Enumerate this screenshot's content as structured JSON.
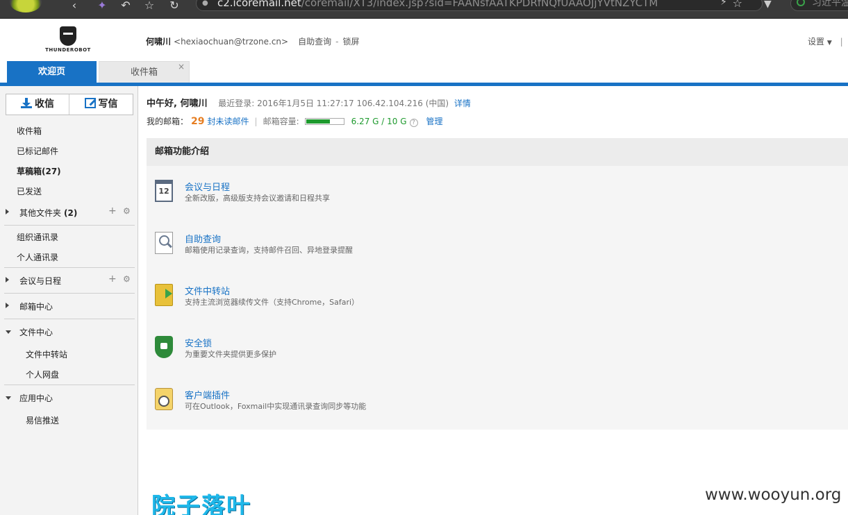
{
  "browser": {
    "url_host": "c2.icoremail.net",
    "url_path": "/coremail/XT3/index.jsp?sid=FAANsfAATKPDRfNQfUAAOJjYVtNZYCTM",
    "search_text": "习近平温"
  },
  "header": {
    "logo_text": "THUNDEROBOT",
    "user_name": "何啸川",
    "user_email": "<hexiaochuan@trzone.cn>",
    "self_query": "自助查询",
    "separator": "-",
    "lock_screen": "锁屏",
    "settings": "设置",
    "settings_caret": "▼",
    "settings_bar": "|"
  },
  "tabs": [
    {
      "label": "欢迎页",
      "active": true
    },
    {
      "label": "收件箱",
      "active": false,
      "close": "×"
    }
  ],
  "sidebar": {
    "receive_button": "收信",
    "write_button": "写信",
    "folders": [
      {
        "label": "收件箱"
      },
      {
        "label": "已标记邮件"
      },
      {
        "label": "草稿箱(27)"
      },
      {
        "label": "已发送"
      }
    ],
    "other_folders": {
      "label": "其他文件夹",
      "count": "(2)",
      "plus": "+",
      "gear": "⚙"
    },
    "org_contacts": "组织通讯录",
    "personal_contacts": "个人通讯录",
    "meetings": {
      "label": "会议与日程",
      "plus": "+",
      "gear": "⚙"
    },
    "mail_center": "邮箱中心",
    "file_center": "文件中心",
    "file_transfer": "文件中转站",
    "personal_disk": "个人网盘",
    "app_center": "应用中心",
    "yixin": "易信推送"
  },
  "main": {
    "greeting": "中午好, 何啸川",
    "last_login": "最近登录: 2016年1月5日 11:27:17 106.42.104.216 (中国)",
    "details": "详情",
    "my_mailbox": "我的邮箱：",
    "unread_count": "29",
    "unread_label": "封未读邮件",
    "bar": "|",
    "capacity_label": "邮箱容量:",
    "capacity_fraction": 0.627,
    "capacity_usage": "6.27 G / 10 G",
    "help": "?",
    "manage": "管理",
    "intro_title": "邮箱功能介绍",
    "features": [
      {
        "icon": "calendar-icon",
        "icon_text": "12",
        "title": "会议与日程",
        "desc": "全新改版，高级版支持会议邀请和日程共享"
      },
      {
        "icon": "search-record-icon",
        "title": "自助查询",
        "desc": "邮箱使用记录查询，支持邮件召回、异地登录提醒"
      },
      {
        "icon": "folder-transfer-icon",
        "title": "文件中转站",
        "desc": "支持主流浏览器续传文件（支持Chrome，Safari）"
      },
      {
        "icon": "shield-lock-icon",
        "title": "安全锁",
        "desc": "为重要文件夹提供更多保护"
      },
      {
        "icon": "plugin-icon",
        "title": "客户端插件",
        "desc": "可在Outlook，Foxmail中实现通讯录查询同步等功能"
      }
    ]
  },
  "watermarks": {
    "cn": "院子落叶",
    "en": "www.wooyun.org"
  }
}
